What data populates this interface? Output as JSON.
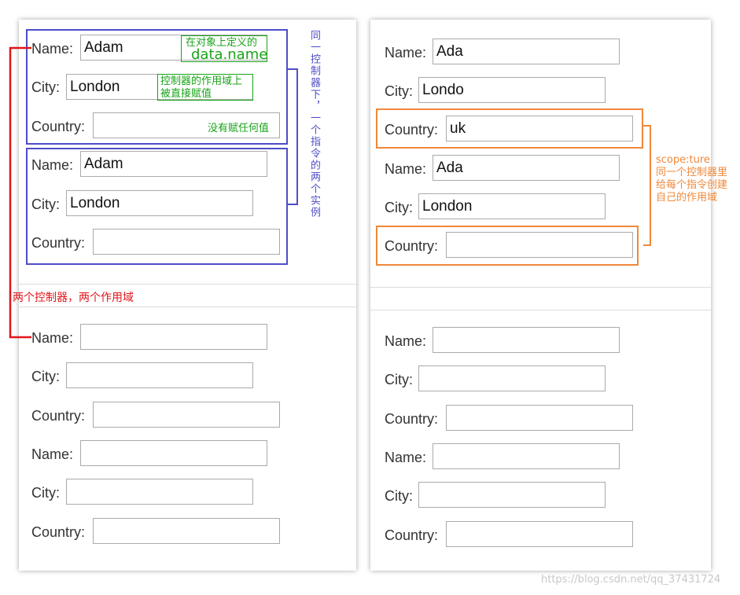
{
  "labels": {
    "name": "Name:",
    "city": "City:",
    "country": "Country:"
  },
  "left": {
    "rows": [
      {
        "key": "name",
        "value": "Adam"
      },
      {
        "key": "city",
        "value": "London"
      },
      {
        "key": "country",
        "value": ""
      },
      {
        "key": "name",
        "value": "Adam"
      },
      {
        "key": "city",
        "value": "London"
      },
      {
        "key": "country",
        "value": ""
      },
      {
        "key": "name",
        "value": ""
      },
      {
        "key": "city",
        "value": ""
      },
      {
        "key": "country",
        "value": ""
      },
      {
        "key": "name",
        "value": ""
      },
      {
        "key": "city",
        "value": ""
      },
      {
        "key": "country",
        "value": ""
      }
    ]
  },
  "right": {
    "rows": [
      {
        "key": "name",
        "value": "Ada"
      },
      {
        "key": "city",
        "value": "Londo"
      },
      {
        "key": "country",
        "value": "uk"
      },
      {
        "key": "name",
        "value": "Ada"
      },
      {
        "key": "city",
        "value": "London"
      },
      {
        "key": "country",
        "value": ""
      },
      {
        "key": "name",
        "value": ""
      },
      {
        "key": "city",
        "value": ""
      },
      {
        "key": "country",
        "value": ""
      },
      {
        "key": "name",
        "value": ""
      },
      {
        "key": "city",
        "value": ""
      },
      {
        "key": "country",
        "value": ""
      }
    ]
  },
  "annotations": {
    "object_defined_1": "在对象上定义的",
    "object_defined_2": "data.name",
    "controller_scope_1": "控制器的作用域上",
    "controller_scope_2": "被直接赋值",
    "no_assignment": "没有赋任何值",
    "vertical_note": "同一控制器下，一个指令的两个实例",
    "two_controllers": "两个控制器，两个作用域",
    "scope_true_1": "scope:ture",
    "scope_true_2": "同一个控制器里",
    "scope_true_3": "给每个指令创建",
    "scope_true_4": "自己的作用域"
  },
  "watermark": "https://blog.csdn.net/qq_37431724",
  "colors": {
    "blue": "#4d4dc8",
    "red": "#e0161b",
    "orange": "#f0883a",
    "green": "#19a319"
  }
}
